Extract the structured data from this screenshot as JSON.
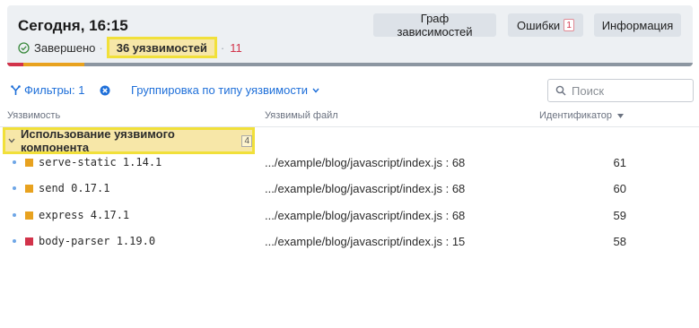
{
  "header": {
    "title": "Сегодня, 16:15",
    "status": "Завершено",
    "vuln_count": "36 уязвимостей",
    "red_count": "11",
    "buttons": {
      "graph": "Граф зависимостей",
      "errors": "Ошибки",
      "errors_badge": "1",
      "info": "Информация"
    },
    "progress": [
      {
        "color": "#d2334a",
        "fraction": 0.024
      },
      {
        "color": "#e8a21f",
        "fraction": 0.088
      }
    ],
    "progress_rest_color": "#8c96a1"
  },
  "toolbar": {
    "filters": "Фильтры: 1",
    "grouping": "Группировка по типу уязвимости",
    "search_placeholder": "Поиск"
  },
  "columns": {
    "vulnerability": "Уязвимость",
    "file": "Уязвимый файл",
    "identifier": "Идентификатор"
  },
  "group": {
    "label": "Использование уязвимого компонента",
    "count": "4"
  },
  "rows": [
    {
      "component": "serve-static 1.14.1",
      "file": ".../example/blog/javascript/index.js : 68",
      "id": "61",
      "severity_color": "#e8a21f"
    },
    {
      "component": "send 0.17.1",
      "file": ".../example/blog/javascript/index.js : 68",
      "id": "60",
      "severity_color": "#e8a21f"
    },
    {
      "component": "express 4.17.1",
      "file": ".../example/blog/javascript/index.js : 68",
      "id": "59",
      "severity_color": "#e8a21f"
    },
    {
      "component": "body-parser 1.19.0",
      "file": ".../example/blog/javascript/index.js : 15",
      "id": "58",
      "severity_color": "#d2334a"
    }
  ]
}
